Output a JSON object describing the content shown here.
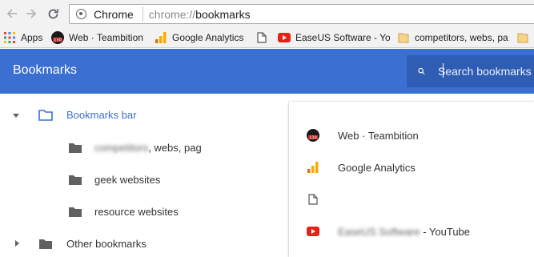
{
  "omnibox": {
    "origin_label": "Chrome",
    "url_scheme": "chrome://",
    "url_path": "bookmarks"
  },
  "bookmarks_bar": [
    {
      "label": "Apps",
      "icon": "apps-grid-icon"
    },
    {
      "label": "Web · Teambition",
      "icon": "teambition-icon"
    },
    {
      "label": "Google Analytics",
      "icon": "google-analytics-icon"
    },
    {
      "label": "",
      "icon": "page-icon"
    },
    {
      "label": "EaseUS Software - Yo",
      "icon": "youtube-icon"
    },
    {
      "label": "competitors, webs, pa",
      "icon": "folder-icon"
    },
    {
      "label": "",
      "icon": "folder-icon"
    }
  ],
  "header": {
    "title": "Bookmarks",
    "search_placeholder": "Search bookmarks"
  },
  "sidebar": {
    "root": {
      "label": "Bookmarks bar"
    },
    "children": [
      {
        "label_blurred": "competitors",
        "label_tail": ", webs, pag"
      },
      {
        "label": "geek websites"
      },
      {
        "label": "resource websites"
      }
    ],
    "other": {
      "label": "Other bookmarks"
    }
  },
  "list": [
    {
      "label": "Web · Teambition",
      "icon": "teambition-icon"
    },
    {
      "label": "Google Analytics",
      "icon": "google-analytics-icon"
    },
    {
      "label": "",
      "icon": "page-icon"
    },
    {
      "label_blurred": "EaseUS Software",
      "label_tail": " - YouTube",
      "icon": "youtube-icon"
    }
  ],
  "colors": {
    "header": "#3b6fd1",
    "search_bg": "#2f5db4",
    "accent": "#3b6fd1",
    "folder": "#616161",
    "youtube": "#e62117",
    "analytics": "#f9ab00"
  }
}
